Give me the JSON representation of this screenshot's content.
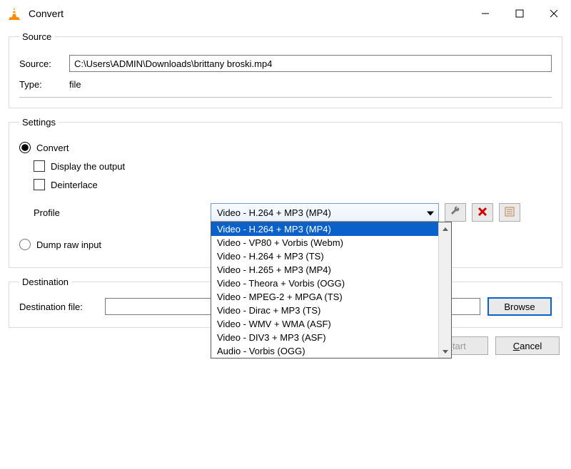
{
  "window": {
    "title": "Convert",
    "icon_name": "vlc-cone-icon"
  },
  "source_group": {
    "legend": "Source",
    "source_label": "Source:",
    "source_value": "C:\\Users\\ADMIN\\Downloads\\brittany broski.mp4",
    "type_label": "Type:",
    "type_value": "file"
  },
  "settings_group": {
    "legend": "Settings",
    "convert_radio": "Convert",
    "display_output_checkbox": "Display the output",
    "deinterlace_checkbox": "Deinterlace",
    "profile_label": "Profile",
    "profile_selected": "Video - H.264 + MP3 (MP4)",
    "profile_options": [
      "Video - H.264 + MP3 (MP4)",
      "Video - VP80 + Vorbis (Webm)",
      "Video - H.264 + MP3 (TS)",
      "Video - H.265 + MP3 (MP4)",
      "Video - Theora + Vorbis (OGG)",
      "Video - MPEG-2 + MPGA (TS)",
      "Video - Dirac + MP3 (TS)",
      "Video - WMV + WMA (ASF)",
      "Video - DIV3 + MP3 (ASF)",
      "Audio - Vorbis (OGG)"
    ],
    "dump_raw_radio": "Dump raw input",
    "icon_buttons": {
      "wrench": "wrench-icon",
      "delete": "delete-x-icon",
      "new": "new-profile-icon"
    }
  },
  "destination_group": {
    "legend": "Destination",
    "dest_label": "Destination file:",
    "dest_value": "",
    "browse_button": "Browse"
  },
  "bottom": {
    "start_button": "Start",
    "cancel_button": "Cancel"
  }
}
